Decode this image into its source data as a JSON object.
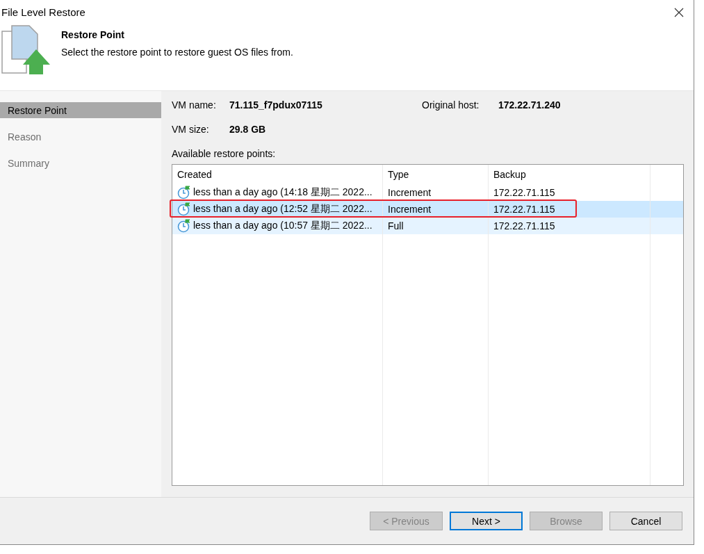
{
  "window": {
    "title": "File Level Restore"
  },
  "header": {
    "title": "Restore Point",
    "description": "Select the restore point to restore guest OS files from."
  },
  "sidebar": {
    "items": [
      {
        "label": "Restore Point",
        "selected": true
      },
      {
        "label": "Reason",
        "selected": false
      },
      {
        "label": "Summary",
        "selected": false
      }
    ]
  },
  "info": [
    {
      "label": "VM name:",
      "value": "71.115_f7pdux07115"
    },
    {
      "label": "Original host:",
      "value": "172.22.71.240"
    },
    {
      "label": "VM size:",
      "value": "29.8 GB"
    }
  ],
  "table": {
    "label": "Available restore points:",
    "columns": [
      "Created",
      "Type",
      "Backup"
    ],
    "rows": [
      {
        "created": "less than a day ago (14:18 星期二 2022...",
        "type": "Increment",
        "backup": "172.22.71.115",
        "selected": false,
        "hovered": false,
        "outlined": false
      },
      {
        "created": "less than a day ago (12:52 星期二 2022...",
        "type": "Increment",
        "backup": "172.22.71.115",
        "selected": true,
        "hovered": false,
        "outlined": true
      },
      {
        "created": "less than a day ago (10:57 星期二 2022...",
        "type": "Full",
        "backup": "172.22.71.115",
        "selected": false,
        "hovered": true,
        "outlined": false
      }
    ]
  },
  "buttons": [
    {
      "label": "< Previous",
      "disabled": true,
      "focused": false
    },
    {
      "label": "Next >",
      "disabled": false,
      "focused": true
    },
    {
      "label": "Browse",
      "disabled": true,
      "focused": false
    },
    {
      "label": "Cancel",
      "disabled": false,
      "focused": false
    }
  ]
}
